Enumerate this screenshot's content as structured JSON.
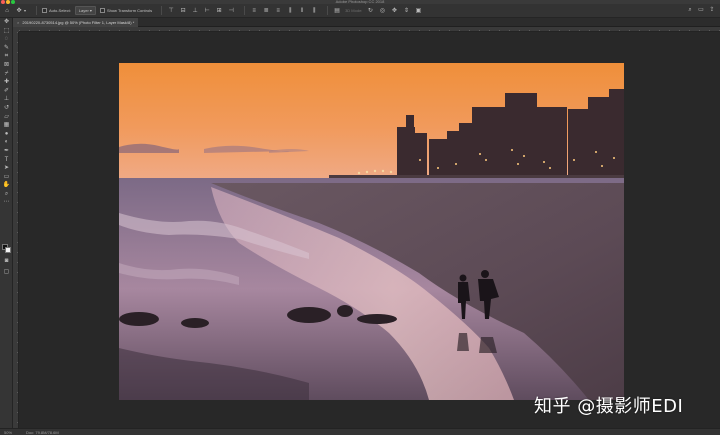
{
  "window": {
    "title": "Adobe Photoshop CC 2018",
    "traffic_light_colors": {
      "close": "#fc5f57",
      "minimize": "#fdbc2e",
      "maximize": "#28c840"
    }
  },
  "options_bar": {
    "tool_icon": "move-tool-icon",
    "auto_select_label": "Auto-Select:",
    "auto_select_value": "Layer",
    "transform_controls_label": "Show Transform Controls",
    "mode_3d_label": "3D Mode:"
  },
  "document": {
    "tab_label": "20190220-8730514.jpg @ 50% (Photo Filter 1, Layer Mask/8) *"
  },
  "status_bar": {
    "zoom": "50%",
    "doc_info": "Doc: 79.8M/78.6M"
  },
  "watermark": "知乎 @摄影师EDI",
  "colors": {
    "ui_dark": "#282828",
    "panel": "#353535",
    "sky_top": "#f0933e",
    "sky_bottom": "#f0a879",
    "sand": "#5a4a54"
  }
}
